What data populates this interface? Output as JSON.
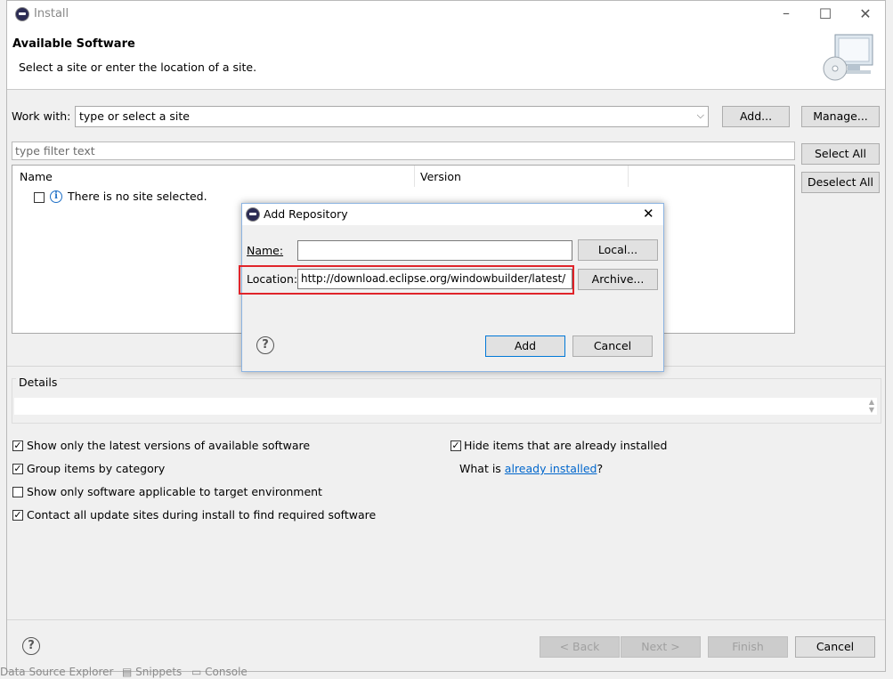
{
  "window": {
    "title": "Install",
    "controls": {
      "minimize": "–",
      "maximize": "☐",
      "close": "✕"
    }
  },
  "header": {
    "title": "Available Software",
    "subtitle": "Select a site or enter the location of a site."
  },
  "work_with": {
    "label": "Work with:",
    "value": "type or select a site",
    "add_button": "Add...",
    "manage_button": "Manage..."
  },
  "filter": {
    "placeholder": "type filter text",
    "select_all": "Select All",
    "deselect_all": "Deselect All"
  },
  "table": {
    "columns": [
      "Name",
      "Version"
    ],
    "rows": [
      {
        "label": "There is no site selected.",
        "icon": "info-icon"
      }
    ]
  },
  "details": {
    "label": "Details"
  },
  "options": {
    "latest_versions": {
      "label": "Show only the latest versions of available software",
      "checked": true
    },
    "group_by_category": {
      "label": "Group items by category",
      "checked": true
    },
    "target_env": {
      "label": "Show only software applicable to target environment",
      "checked": false
    },
    "contact_sites": {
      "label": "Contact all update sites during install to find required software",
      "checked": true
    },
    "hide_installed": {
      "label": "Hide items that are already installed",
      "checked": true
    },
    "what_is_prefix": "What is ",
    "what_is_link": "already installed",
    "what_is_suffix": "?"
  },
  "footer": {
    "back": "< Back",
    "next": "Next >",
    "finish": "Finish",
    "cancel": "Cancel"
  },
  "background_tabs": [
    "Data Source Explorer",
    "Snippets",
    "Console"
  ],
  "dialog": {
    "title": "Add Repository",
    "name_label": "Name:",
    "name_value": "",
    "local_button": "Local...",
    "location_label": "Location:",
    "location_value": "http://download.eclipse.org/windowbuilder/latest/",
    "archive_button": "Archive...",
    "add_button": "Add",
    "cancel_button": "Cancel",
    "highlight_color": "#e0242a"
  }
}
